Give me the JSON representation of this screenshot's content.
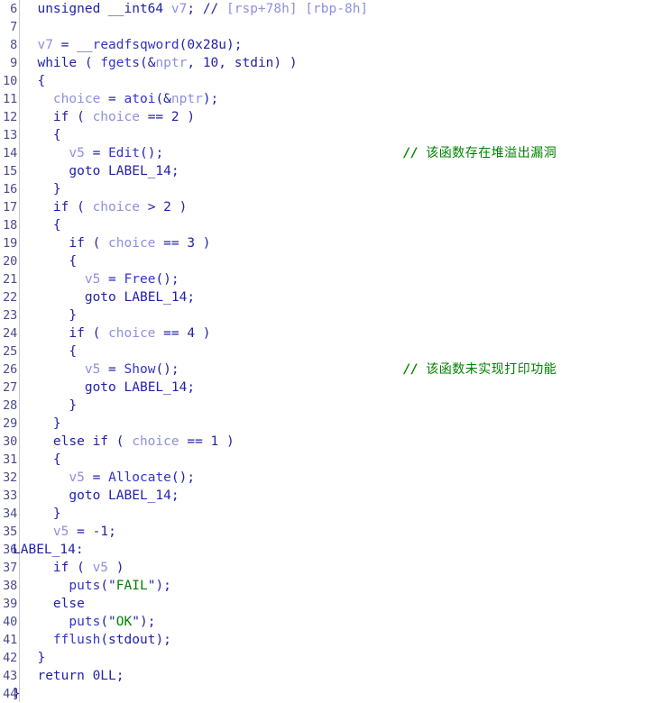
{
  "view": {
    "name": "hex-rays-pseudocode",
    "background": "#ffffff",
    "gutter_rule_color": "#c8c8c8",
    "line_height_px": 20,
    "first_line_number": 6,
    "last_line_number": 44
  },
  "colors": {
    "keyword": "#2222a8",
    "function": "#3333cc",
    "variable": "#8f8fe0",
    "string": "#008000",
    "comment": "#008000",
    "linenumber": "#4a4a8c"
  },
  "lines": [
    {
      "number": "6",
      "tokens": [
        {
          "t": "  unsigned __int64 ",
          "c": "kw"
        },
        {
          "t": "v7",
          "c": "var"
        },
        {
          "t": "; ",
          "c": "kw"
        },
        {
          "t": "// ",
          "c": "cmt"
        },
        {
          "t": "[rsp+78h] [rbp-8h]",
          "c": "var"
        }
      ]
    },
    {
      "number": "7",
      "tokens": []
    },
    {
      "number": "8",
      "tokens": [
        {
          "t": "  ",
          "c": "kw"
        },
        {
          "t": "v7",
          "c": "var"
        },
        {
          "t": " = ",
          "c": "kw"
        },
        {
          "t": "__readfsqword",
          "c": "fn"
        },
        {
          "t": "(",
          "c": "kw"
        },
        {
          "t": "0x28u",
          "c": "num"
        },
        {
          "t": ");",
          "c": "kw"
        }
      ]
    },
    {
      "number": "9",
      "tokens": [
        {
          "t": "  while ( ",
          "c": "kw"
        },
        {
          "t": "fgets",
          "c": "fn"
        },
        {
          "t": "(&",
          "c": "kw"
        },
        {
          "t": "nptr",
          "c": "var"
        },
        {
          "t": ", ",
          "c": "kw"
        },
        {
          "t": "10",
          "c": "num"
        },
        {
          "t": ", ",
          "c": "kw"
        },
        {
          "t": "stdin",
          "c": "kw"
        },
        {
          "t": ") )",
          "c": "kw"
        }
      ]
    },
    {
      "number": "10",
      "tokens": [
        {
          "t": "  {",
          "c": "kw"
        }
      ]
    },
    {
      "number": "11",
      "tokens": [
        {
          "t": "    ",
          "c": "kw"
        },
        {
          "t": "choice",
          "c": "var"
        },
        {
          "t": " = ",
          "c": "kw"
        },
        {
          "t": "atoi",
          "c": "fn"
        },
        {
          "t": "(&",
          "c": "kw"
        },
        {
          "t": "nptr",
          "c": "var"
        },
        {
          "t": ");",
          "c": "kw"
        }
      ]
    },
    {
      "number": "12",
      "tokens": [
        {
          "t": "    if ( ",
          "c": "kw"
        },
        {
          "t": "choice",
          "c": "var"
        },
        {
          "t": " == ",
          "c": "kw"
        },
        {
          "t": "2",
          "c": "num"
        },
        {
          "t": " )",
          "c": "kw"
        }
      ]
    },
    {
      "number": "13",
      "tokens": [
        {
          "t": "    {",
          "c": "kw"
        }
      ]
    },
    {
      "number": "14",
      "tokens": [
        {
          "t": "      ",
          "c": "kw"
        },
        {
          "t": "v5",
          "c": "var"
        },
        {
          "t": " = ",
          "c": "kw"
        },
        {
          "t": "Edit",
          "c": "fn"
        },
        {
          "t": "();",
          "c": "kw"
        }
      ],
      "comment": "该函数存在堆溢出漏洞"
    },
    {
      "number": "15",
      "tokens": [
        {
          "t": "      goto ",
          "c": "kw"
        },
        {
          "t": "LABEL_14",
          "c": "lbl"
        },
        {
          "t": ";",
          "c": "kw"
        }
      ]
    },
    {
      "number": "16",
      "tokens": [
        {
          "t": "    }",
          "c": "kw"
        }
      ]
    },
    {
      "number": "17",
      "tokens": [
        {
          "t": "    if ( ",
          "c": "kw"
        },
        {
          "t": "choice",
          "c": "var"
        },
        {
          "t": " > ",
          "c": "kw"
        },
        {
          "t": "2",
          "c": "num"
        },
        {
          "t": " )",
          "c": "kw"
        }
      ]
    },
    {
      "number": "18",
      "tokens": [
        {
          "t": "    {",
          "c": "kw"
        }
      ]
    },
    {
      "number": "19",
      "tokens": [
        {
          "t": "      if ( ",
          "c": "kw"
        },
        {
          "t": "choice",
          "c": "var"
        },
        {
          "t": " == ",
          "c": "kw"
        },
        {
          "t": "3",
          "c": "num"
        },
        {
          "t": " )",
          "c": "kw"
        }
      ]
    },
    {
      "number": "20",
      "tokens": [
        {
          "t": "      {",
          "c": "kw"
        }
      ]
    },
    {
      "number": "21",
      "tokens": [
        {
          "t": "        ",
          "c": "kw"
        },
        {
          "t": "v5",
          "c": "var"
        },
        {
          "t": " = ",
          "c": "kw"
        },
        {
          "t": "Free",
          "c": "fn"
        },
        {
          "t": "();",
          "c": "kw"
        }
      ]
    },
    {
      "number": "22",
      "tokens": [
        {
          "t": "        goto ",
          "c": "kw"
        },
        {
          "t": "LABEL_14",
          "c": "lbl"
        },
        {
          "t": ";",
          "c": "kw"
        }
      ]
    },
    {
      "number": "23",
      "tokens": [
        {
          "t": "      }",
          "c": "kw"
        }
      ]
    },
    {
      "number": "24",
      "tokens": [
        {
          "t": "      if ( ",
          "c": "kw"
        },
        {
          "t": "choice",
          "c": "var"
        },
        {
          "t": " == ",
          "c": "kw"
        },
        {
          "t": "4",
          "c": "num"
        },
        {
          "t": " )",
          "c": "kw"
        }
      ]
    },
    {
      "number": "25",
      "tokens": [
        {
          "t": "      {",
          "c": "kw"
        }
      ]
    },
    {
      "number": "26",
      "tokens": [
        {
          "t": "        ",
          "c": "kw"
        },
        {
          "t": "v5",
          "c": "var"
        },
        {
          "t": " = ",
          "c": "kw"
        },
        {
          "t": "Show",
          "c": "fn"
        },
        {
          "t": "();",
          "c": "kw"
        }
      ],
      "comment": "该函数未实现打印功能"
    },
    {
      "number": "27",
      "tokens": [
        {
          "t": "        goto ",
          "c": "kw"
        },
        {
          "t": "LABEL_14",
          "c": "lbl"
        },
        {
          "t": ";",
          "c": "kw"
        }
      ]
    },
    {
      "number": "28",
      "tokens": [
        {
          "t": "      }",
          "c": "kw"
        }
      ]
    },
    {
      "number": "29",
      "tokens": [
        {
          "t": "    }",
          "c": "kw"
        }
      ]
    },
    {
      "number": "30",
      "tokens": [
        {
          "t": "    else if ( ",
          "c": "kw"
        },
        {
          "t": "choice",
          "c": "var"
        },
        {
          "t": " == ",
          "c": "kw"
        },
        {
          "t": "1",
          "c": "num"
        },
        {
          "t": " )",
          "c": "kw"
        }
      ]
    },
    {
      "number": "31",
      "tokens": [
        {
          "t": "    {",
          "c": "kw"
        }
      ]
    },
    {
      "number": "32",
      "tokens": [
        {
          "t": "      ",
          "c": "kw"
        },
        {
          "t": "v5",
          "c": "var"
        },
        {
          "t": " = ",
          "c": "kw"
        },
        {
          "t": "Allocate",
          "c": "fn"
        },
        {
          "t": "();",
          "c": "kw"
        }
      ]
    },
    {
      "number": "33",
      "tokens": [
        {
          "t": "      goto ",
          "c": "kw"
        },
        {
          "t": "LABEL_14",
          "c": "lbl"
        },
        {
          "t": ";",
          "c": "kw"
        }
      ]
    },
    {
      "number": "34",
      "tokens": [
        {
          "t": "    }",
          "c": "kw"
        }
      ]
    },
    {
      "number": "35",
      "tokens": [
        {
          "t": "    ",
          "c": "kw"
        },
        {
          "t": "v5",
          "c": "var"
        },
        {
          "t": " = ",
          "c": "kw"
        },
        {
          "t": "-1",
          "c": "num"
        },
        {
          "t": ";",
          "c": "kw"
        }
      ]
    },
    {
      "number": "36",
      "flush": true,
      "tokens": [
        {
          "t": "LABEL_14",
          "c": "lbl"
        },
        {
          "t": ":",
          "c": "kw"
        }
      ]
    },
    {
      "number": "37",
      "tokens": [
        {
          "t": "    if ( ",
          "c": "kw"
        },
        {
          "t": "v5",
          "c": "var"
        },
        {
          "t": " )",
          "c": "kw"
        }
      ]
    },
    {
      "number": "38",
      "tokens": [
        {
          "t": "      ",
          "c": "kw"
        },
        {
          "t": "puts",
          "c": "fn"
        },
        {
          "t": "(",
          "c": "kw"
        },
        {
          "t": "\"",
          "c": "quote"
        },
        {
          "t": "FAIL",
          "c": "str"
        },
        {
          "t": "\"",
          "c": "quote"
        },
        {
          "t": ");",
          "c": "kw"
        }
      ]
    },
    {
      "number": "39",
      "tokens": [
        {
          "t": "    else",
          "c": "kw"
        }
      ]
    },
    {
      "number": "40",
      "tokens": [
        {
          "t": "      ",
          "c": "kw"
        },
        {
          "t": "puts",
          "c": "fn"
        },
        {
          "t": "(",
          "c": "kw"
        },
        {
          "t": "\"",
          "c": "quote"
        },
        {
          "t": "OK",
          "c": "str"
        },
        {
          "t": "\"",
          "c": "quote"
        },
        {
          "t": ");",
          "c": "kw"
        }
      ]
    },
    {
      "number": "41",
      "tokens": [
        {
          "t": "    ",
          "c": "kw"
        },
        {
          "t": "fflush",
          "c": "fn"
        },
        {
          "t": "(",
          "c": "kw"
        },
        {
          "t": "stdout",
          "c": "kw"
        },
        {
          "t": ");",
          "c": "kw"
        }
      ]
    },
    {
      "number": "42",
      "tokens": [
        {
          "t": "  }",
          "c": "kw"
        }
      ]
    },
    {
      "number": "43",
      "tokens": [
        {
          "t": "  return ",
          "c": "kw"
        },
        {
          "t": "0LL",
          "c": "num"
        },
        {
          "t": ";",
          "c": "kw"
        }
      ]
    },
    {
      "number": "44",
      "flush": true,
      "tokens": [
        {
          "t": "}",
          "c": "kw"
        }
      ]
    }
  ]
}
